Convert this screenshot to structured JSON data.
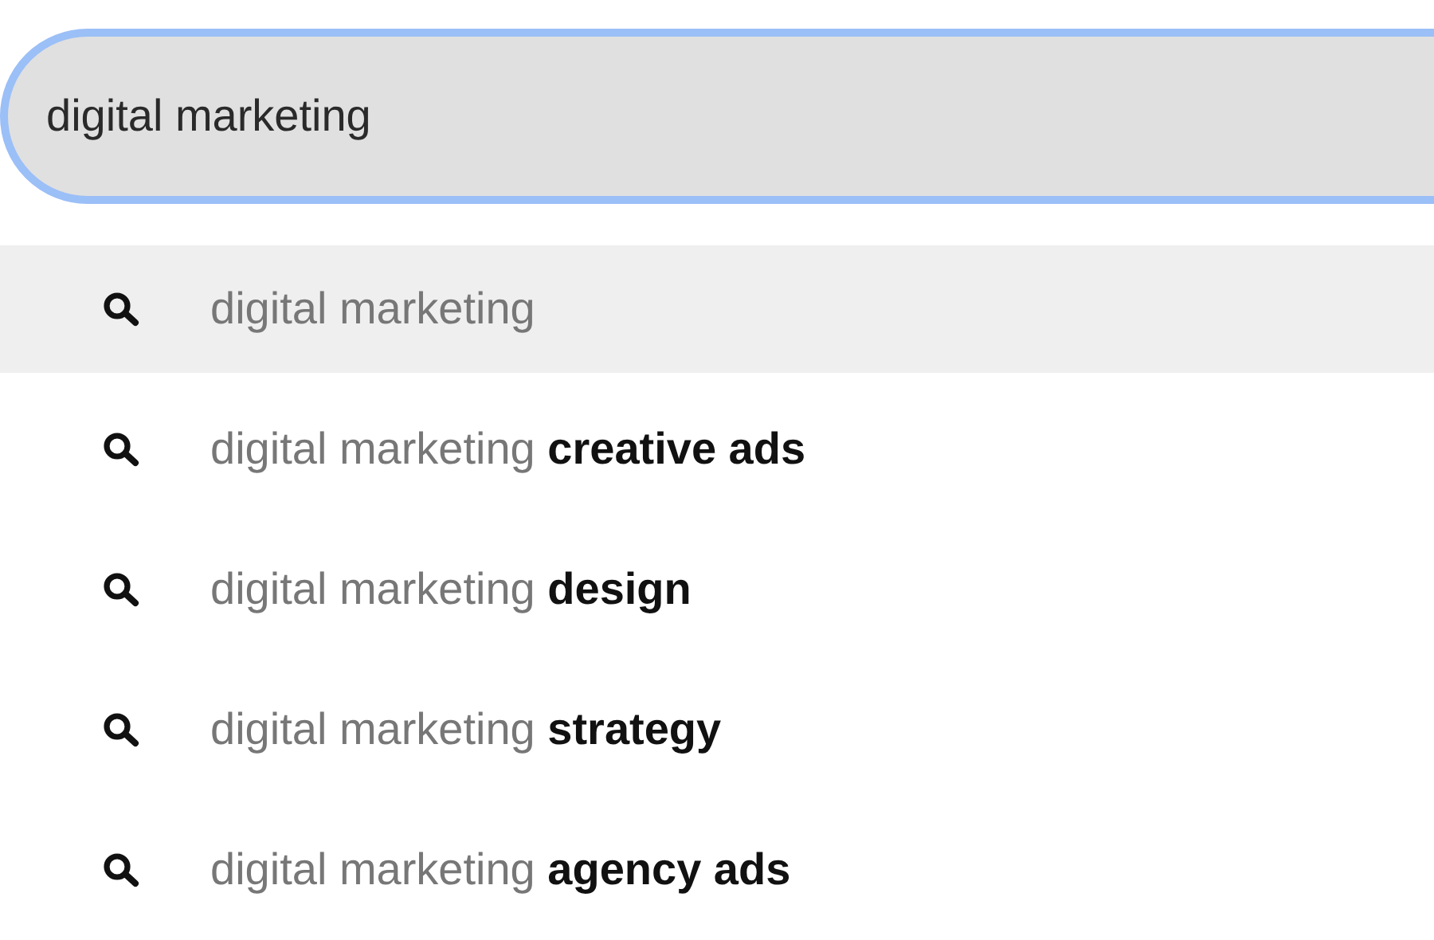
{
  "search": {
    "value": "digital marketing"
  },
  "suggestions": [
    {
      "text": "digital marketing",
      "selected": true
    },
    {
      "text": "digital marketing **creative ads**",
      "selected": false
    },
    {
      "text": "digital marketing **design**",
      "selected": false
    },
    {
      "text": "digital marketing **strategy**",
      "selected": false
    },
    {
      "text": "digital marketing **agency ads**",
      "selected": false
    }
  ]
}
